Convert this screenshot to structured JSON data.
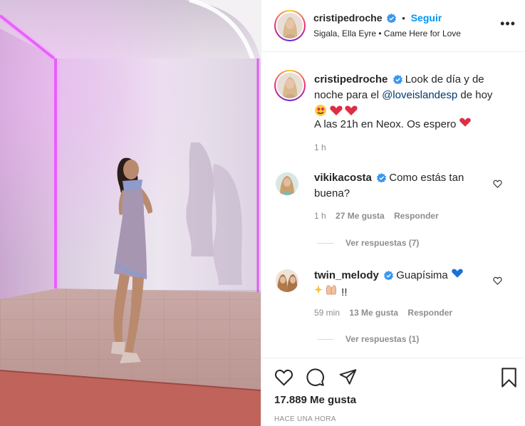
{
  "post": {
    "username": "cristipedroche",
    "follow_label": "Seguir",
    "dot": "•",
    "song": "Sigala, Ella Eyre • Came Here for Love",
    "more": "•••"
  },
  "caption": {
    "username": "cristipedroche",
    "text_1": "Look de día y de",
    "text_2": "noche para el",
    "mention": "@loveislandesp",
    "text_3": "de hoy",
    "text_4": "A las 21h en Neox. Os espero",
    "time": "1 h"
  },
  "comments": [
    {
      "username": "vikikacosta",
      "text_1": "Como estás tan",
      "text_2": "buena?",
      "time": "1 h",
      "likes": "27 Me gusta",
      "reply": "Responder",
      "view_replies": "Ver respuestas (7)"
    },
    {
      "username": "twin_melody",
      "text_1": "Guapísima",
      "text_2": "!!",
      "time": "59 min",
      "likes": "13 Me gusta",
      "reply": "Responder",
      "view_replies": "Ver respuestas (1)"
    }
  ],
  "footer": {
    "likes": "17.889 Me gusta",
    "timestamp": "HACE UNA HORA"
  },
  "colors": {
    "accent": "#0095f6",
    "verified": "#3897f0",
    "heart": "#ed4956",
    "blue_heart": "#1c6fd6",
    "neon": "#e040fb"
  },
  "icons": [
    "verified-icon",
    "more-icon",
    "heart-outline-icon",
    "comment-icon",
    "share-icon",
    "bookmark-icon"
  ]
}
